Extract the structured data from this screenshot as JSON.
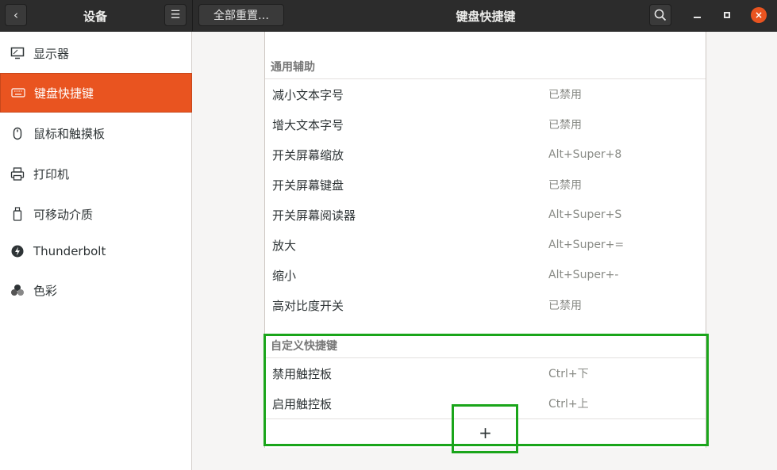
{
  "header": {
    "left_title": "设备",
    "main_title": "键盘快捷键",
    "reset_label": "全部重置…",
    "back_icon": "‹",
    "menu_icon": "☰",
    "close_icon": "×"
  },
  "sidebar": {
    "items": [
      {
        "label": "显示器",
        "icon": "display-icon"
      },
      {
        "label": "键盘快捷键",
        "icon": "keyboard-icon"
      },
      {
        "label": "鼠标和触摸板",
        "icon": "mouse-icon"
      },
      {
        "label": "打印机",
        "icon": "printer-icon"
      },
      {
        "label": "可移动介质",
        "icon": "removable-media-icon"
      },
      {
        "label": "Thunderbolt",
        "icon": "thunderbolt-icon"
      },
      {
        "label": "色彩",
        "icon": "color-icon"
      }
    ]
  },
  "sections": {
    "accessibility": {
      "title": "通用辅助",
      "rows": [
        {
          "name": "减小文本字号",
          "accel": "已禁用"
        },
        {
          "name": "增大文本字号",
          "accel": "已禁用"
        },
        {
          "name": "开关屏幕缩放",
          "accel": "Alt+Super+8"
        },
        {
          "name": "开关屏幕键盘",
          "accel": "已禁用"
        },
        {
          "name": "开关屏幕阅读器",
          "accel": "Alt+Super+S"
        },
        {
          "name": "放大",
          "accel": "Alt+Super+="
        },
        {
          "name": "缩小",
          "accel": "Alt+Super+-"
        },
        {
          "name": "高对比度开关",
          "accel": "已禁用"
        }
      ]
    },
    "custom": {
      "title": "自定义快捷键",
      "rows": [
        {
          "name": "禁用触控板",
          "accel": "Ctrl+下"
        },
        {
          "name": "启用触控板",
          "accel": "Ctrl+上"
        }
      ],
      "add_label": "+"
    }
  },
  "colors": {
    "accent": "#e95420",
    "highlight": "#1aa51a",
    "header_bg": "#2c2c2c"
  }
}
